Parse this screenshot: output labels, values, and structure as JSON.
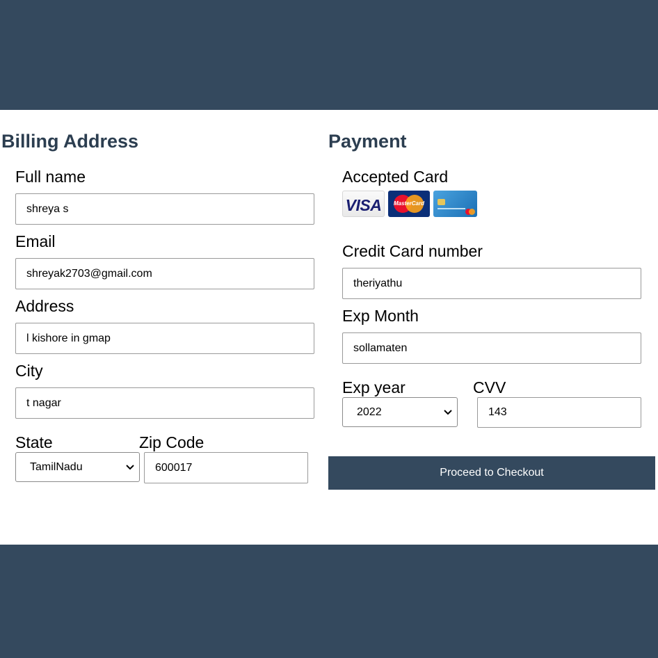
{
  "billing": {
    "heading": "Billing Address",
    "full_name": {
      "label": "Full name",
      "value": "shreya s"
    },
    "email": {
      "label": "Email",
      "value": "shreyak2703@gmail.com"
    },
    "address": {
      "label": "Address",
      "value": "l kishore in gmap"
    },
    "city": {
      "label": "City",
      "value": "t nagar"
    },
    "state": {
      "label": "State",
      "selected": "TamilNadu"
    },
    "zip": {
      "label": "Zip Code",
      "value": "600017"
    }
  },
  "payment": {
    "heading": "Payment",
    "accepted_label": "Accepted Card",
    "card_icons": [
      "visa-icon",
      "mastercard-icon",
      "credit-card-icon"
    ],
    "card_number": {
      "label": "Credit Card number",
      "value": "theriyathu"
    },
    "exp_month": {
      "label": "Exp Month",
      "value": "sollamaten"
    },
    "exp_year": {
      "label": "Exp year",
      "selected": "2022"
    },
    "cvv": {
      "label": "CVV",
      "value": "143"
    },
    "checkout_label": "Proceed to Checkout"
  },
  "colors": {
    "header_band": "#34495e",
    "button_bg": "#34495e",
    "heading": "#2c3e50"
  }
}
